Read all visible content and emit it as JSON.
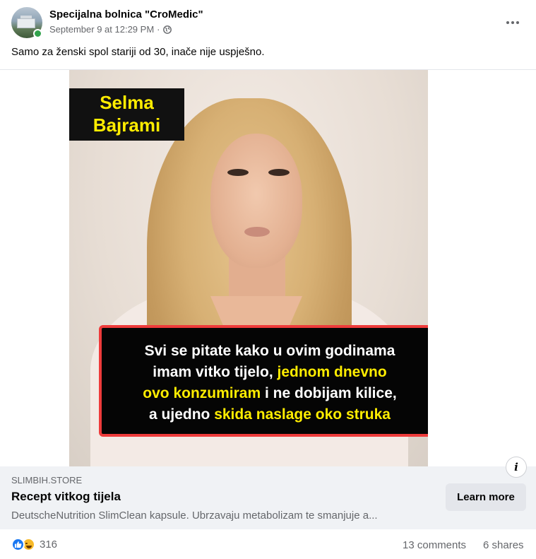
{
  "post": {
    "page_name": "Specijalna bolnica \"CroMedic\"",
    "timestamp": "September 9 at 12:29 PM",
    "separator": "·",
    "privacy_icon": "globe-icon",
    "caption": "Samo za ženski spol stariji od 30, inače nije uspješno."
  },
  "image": {
    "name_lines": [
      "Selma",
      "Bajrami"
    ],
    "quote": {
      "line1": "Svi se pitate kako u ovim godinama",
      "line2_a": "imam vitko tijelo, ",
      "line2_b": "jednom dnevno",
      "line3_a": "ovo konzumiram",
      "line3_b": " i ne dobijam kilice,",
      "line4_a": "a ujedno ",
      "line4_b": "skida naslage oko struka"
    },
    "colors": {
      "highlight": "#ffed00",
      "box_border": "#ee3b3b",
      "box_bg": "#050505"
    }
  },
  "link_card": {
    "domain": "SLIMBIH.STORE",
    "title": "Recept vitkog tijela",
    "description": "DeutscheNutrition SlimClean kapsule. Ubrzavaju metabolizam te smanjuje a...",
    "button_label": "Learn more",
    "info_label": "i"
  },
  "footer": {
    "reaction_icons": [
      "like-icon",
      "haha-icon"
    ],
    "reaction_count": "316",
    "comments": "13 comments",
    "shares": "6 shares"
  }
}
